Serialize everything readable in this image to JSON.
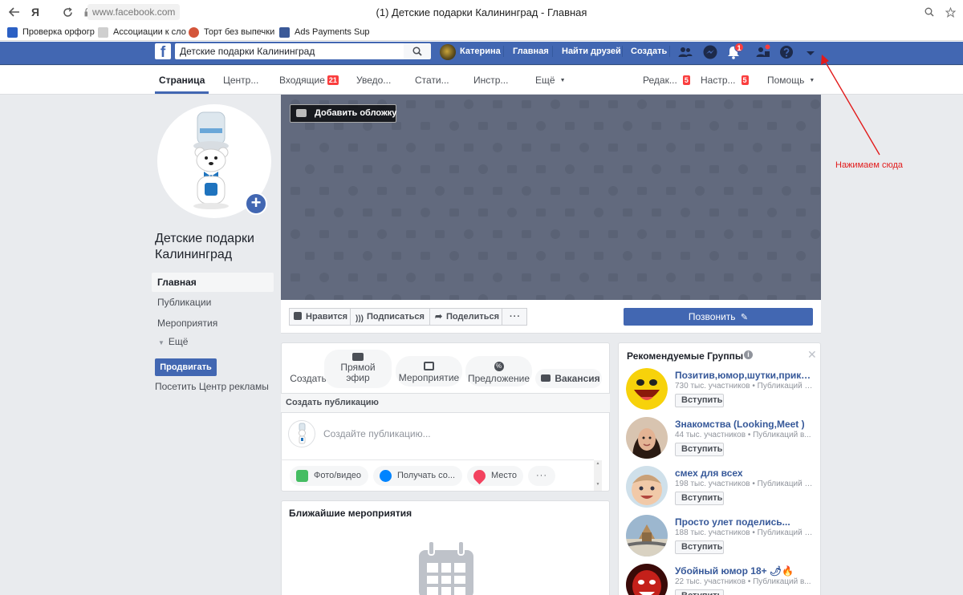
{
  "browser": {
    "url": "www.facebook.com",
    "title": "(1) Детские подарки Калининград - Главная",
    "yandex_label": "Я",
    "bookmarks": [
      {
        "label": "Проверка орфогр",
        "icon": "spellcheck-icon",
        "color": "#2b60c4"
      },
      {
        "label": "Ассоциации к сло",
        "icon": "sparkle-icon",
        "color": "#888888"
      },
      {
        "label": "Торт без выпечки",
        "icon": "cake-icon",
        "color": "#d4553a"
      },
      {
        "label": "Ads Payments Sup",
        "icon": "facebook-icon",
        "color": "#3b5998"
      }
    ]
  },
  "fb_header": {
    "search_value": "Детские подарки Калининград",
    "user_name": "Катерина",
    "nav": [
      "Главная",
      "Найти друзей",
      "Создать"
    ],
    "notification_count": "1",
    "brand_color": "#4267b2"
  },
  "page_tabs": {
    "left": [
      {
        "label": "Страница",
        "badge": ""
      },
      {
        "label": "Центр...",
        "badge": ""
      },
      {
        "label": "Входящие",
        "badge": "21"
      },
      {
        "label": "Уведо...",
        "badge": ""
      },
      {
        "label": "Стати...",
        "badge": ""
      },
      {
        "label": "Инстр...",
        "badge": ""
      },
      {
        "label": "Ещё",
        "badge": ""
      }
    ],
    "right": [
      {
        "label": "Редак...",
        "badge": "5"
      },
      {
        "label": "Настр...",
        "badge": "5"
      },
      {
        "label": "Помощь",
        "badge": ""
      }
    ]
  },
  "sidebar": {
    "page_name": "Детские подарки Калининград",
    "items": [
      "Главная",
      "Публикации",
      "Мероприятия",
      "Ещё"
    ],
    "promote_label": "Продвигать",
    "ad_center_label": "Посетить Центр рекламы"
  },
  "cover": {
    "add_cover_label": "Добавить обложку"
  },
  "actions": {
    "like": "Нравится",
    "follow": "Подписаться",
    "share": "Поделиться",
    "more": "···",
    "call": "Позвонить"
  },
  "composer": {
    "options": [
      "Создать",
      "Прямой эфир",
      "Мероприятие",
      "Предложение",
      "Вакансия"
    ],
    "header": "Создать публикацию",
    "placeholder": "Создайте публикацию...",
    "pills": [
      {
        "label": "Фото/видео",
        "icon": "photo-icon",
        "color": "#45bd62"
      },
      {
        "label": "Получать со...",
        "icon": "messenger-icon",
        "color": "#0084ff"
      },
      {
        "label": "Место",
        "icon": "location-pin-icon",
        "color": "#f3425f"
      }
    ],
    "more": "···"
  },
  "events": {
    "title": "Ближайшие мероприятия"
  },
  "groups": {
    "title": "Рекомендуемые Группы",
    "join_label": "Вступить",
    "items": [
      {
        "name": "Позитив,юмор,шутки,прикол...",
        "meta": "730 тыс. участников • Публикаций в..."
      },
      {
        "name": "Знакомства (Looking,Meet )",
        "meta": "44 тыс. участников • Публикаций в..."
      },
      {
        "name": "смех для всех",
        "meta": "198 тыс. участников • Публикаций в..."
      },
      {
        "name": "Просто улет поделись...",
        "meta": "188 тыс. участников • Публикаций в..."
      },
      {
        "name": "Убойный юмор 18+ 🌶🔥",
        "meta": "22 тыс. участников • Публикаций в..."
      }
    ]
  },
  "annotation": {
    "text": "Нажимаем сюда",
    "color": "#e21b1b"
  }
}
